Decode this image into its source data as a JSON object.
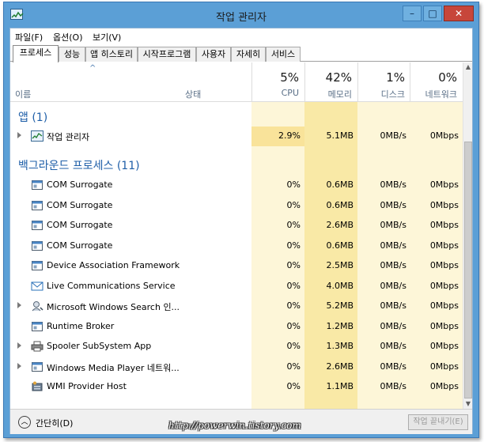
{
  "window": {
    "title": "작업 관리자"
  },
  "menu": [
    "파일(F)",
    "옵션(O)",
    "보기(V)"
  ],
  "tabs": [
    "프로세스",
    "성능",
    "앱 히스토리",
    "시작프로그램",
    "사용자",
    "자세히",
    "서비스"
  ],
  "header": {
    "name": "이름",
    "status": "상태",
    "cpu": {
      "pct": "5%",
      "label": "CPU"
    },
    "memory": {
      "pct": "42%",
      "label": "메모리"
    },
    "disk": {
      "pct": "1%",
      "label": "디스크"
    },
    "network": {
      "pct": "0%",
      "label": "네트워크"
    }
  },
  "groups": {
    "apps": "앱 (1)",
    "background": "백그라운드 프로세스 (11)"
  },
  "apps": [
    {
      "name": "작업 관리자",
      "icon": "task-manager-icon",
      "expandable": true,
      "cpu": "2.9%",
      "memory": "5.1MB",
      "disk": "0MB/s",
      "network": "0Mbps"
    }
  ],
  "background": [
    {
      "name": "COM Surrogate",
      "icon": "window-app-icon",
      "expandable": false,
      "cpu": "0%",
      "memory": "0.6MB",
      "disk": "0MB/s",
      "network": "0Mbps"
    },
    {
      "name": "COM Surrogate",
      "icon": "window-app-icon",
      "expandable": false,
      "cpu": "0%",
      "memory": "0.6MB",
      "disk": "0MB/s",
      "network": "0Mbps"
    },
    {
      "name": "COM Surrogate",
      "icon": "window-app-icon",
      "expandable": false,
      "cpu": "0%",
      "memory": "2.6MB",
      "disk": "0MB/s",
      "network": "0Mbps"
    },
    {
      "name": "COM Surrogate",
      "icon": "window-app-icon",
      "expandable": false,
      "cpu": "0%",
      "memory": "0.6MB",
      "disk": "0MB/s",
      "network": "0Mbps"
    },
    {
      "name": "Device Association Framework ...",
      "icon": "window-app-icon",
      "expandable": false,
      "cpu": "0%",
      "memory": "2.5MB",
      "disk": "0MB/s",
      "network": "0Mbps"
    },
    {
      "name": "Live Communications Service",
      "icon": "mail-icon",
      "expandable": false,
      "cpu": "0%",
      "memory": "4.0MB",
      "disk": "0MB/s",
      "network": "0Mbps"
    },
    {
      "name": "Microsoft Windows Search 인...",
      "icon": "search-user-icon",
      "expandable": true,
      "cpu": "0%",
      "memory": "5.2MB",
      "disk": "0MB/s",
      "network": "0Mbps"
    },
    {
      "name": "Runtime Broker",
      "icon": "window-app-icon",
      "expandable": false,
      "cpu": "0%",
      "memory": "1.2MB",
      "disk": "0MB/s",
      "network": "0Mbps"
    },
    {
      "name": "Spooler SubSystem App",
      "icon": "printer-icon",
      "expandable": true,
      "cpu": "0%",
      "memory": "1.3MB",
      "disk": "0MB/s",
      "network": "0Mbps"
    },
    {
      "name": "Windows Media Player 네트워...",
      "icon": "window-app-icon",
      "expandable": true,
      "cpu": "0%",
      "memory": "2.6MB",
      "disk": "0MB/s",
      "network": "0Mbps"
    },
    {
      "name": "WMI Provider Host",
      "icon": "wmi-host-icon",
      "expandable": false,
      "cpu": "0%",
      "memory": "1.1MB",
      "disk": "0MB/s",
      "network": "0Mbps"
    }
  ],
  "footer": {
    "collapse": "간단히(D)",
    "end_task": "작업 끝내기(E)"
  },
  "watermark": "http://powerwin.tistory.com",
  "colors": {
    "frame": "#5b9fd6",
    "group_text": "#1f5fa8",
    "heat_light": "#fdf6d8",
    "heat_mid": "#fbefb8",
    "heat_hot": "#f9e39a"
  }
}
